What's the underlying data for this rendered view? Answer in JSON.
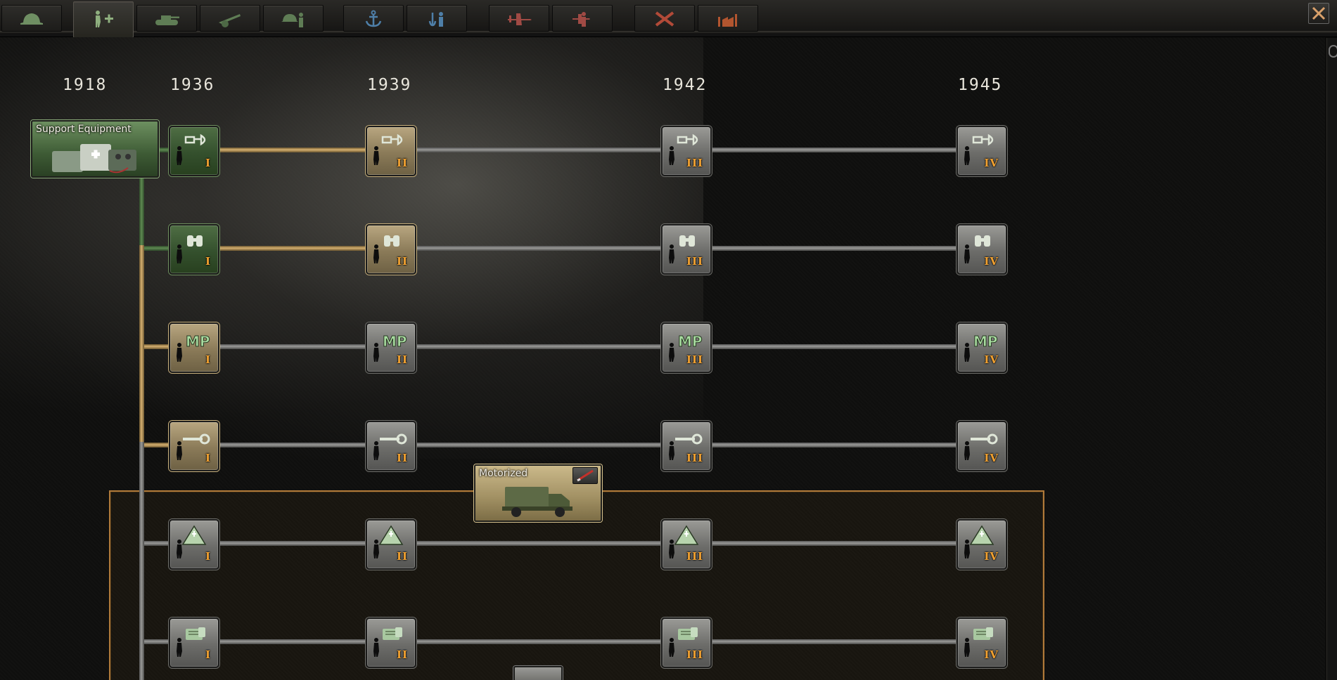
{
  "tabs": [
    {
      "id": "infantry",
      "icon": "helmet-icon"
    },
    {
      "id": "support",
      "icon": "infantry-plus-icon",
      "active": true
    },
    {
      "id": "armor",
      "icon": "tank-icon"
    },
    {
      "id": "artillery",
      "icon": "artillery-icon"
    },
    {
      "id": "land-doctrine",
      "icon": "officer-icon"
    },
    {
      "id": "naval",
      "icon": "anchor-icon"
    },
    {
      "id": "naval-doctrine",
      "icon": "naval-doctrine-icon"
    },
    {
      "id": "air",
      "icon": "plane-icon"
    },
    {
      "id": "air-doctrine",
      "icon": "air-doctrine-icon"
    },
    {
      "id": "engineering",
      "icon": "tools-icon"
    },
    {
      "id": "industry",
      "icon": "factory-icon"
    }
  ],
  "years": [
    "1918",
    "1936",
    "1939",
    "1942",
    "1945"
  ],
  "categories": {
    "support": {
      "title": "Support Equipment",
      "icon": "support-equipment-icon"
    },
    "motorized": {
      "title": "Motorized",
      "icon": "truck-icon",
      "toggle_icon": "rifle-icon"
    }
  },
  "rows": [
    {
      "id": "engineers",
      "icon": "shovel-icon",
      "levels": [
        "I",
        "II",
        "III",
        "IV"
      ],
      "state": [
        "green",
        "done",
        "none",
        "none"
      ]
    },
    {
      "id": "recon",
      "icon": "binoculars-icon",
      "levels": [
        "I",
        "II",
        "III",
        "IV"
      ],
      "state": [
        "green",
        "done",
        "none",
        "none"
      ]
    },
    {
      "id": "military-police",
      "icon": "mp-icon",
      "levels": [
        "I",
        "II",
        "III",
        "IV"
      ],
      "state": [
        "done",
        "none",
        "none",
        "none"
      ],
      "icon_text": "MP"
    },
    {
      "id": "maintenance",
      "icon": "wrench-icon",
      "levels": [
        "I",
        "II",
        "III",
        "IV"
      ],
      "state": [
        "done",
        "none",
        "none",
        "none"
      ]
    },
    {
      "id": "field-hospital",
      "icon": "tent-icon",
      "levels": [
        "I",
        "II",
        "III",
        "IV"
      ],
      "state": [
        "none",
        "none",
        "none",
        "none"
      ]
    },
    {
      "id": "logistics",
      "icon": "supply-icon",
      "levels": [
        "I",
        "II",
        "III",
        "IV"
      ],
      "state": [
        "none",
        "none",
        "none",
        "none"
      ]
    }
  ],
  "colors": {
    "accent_gold": "#d6b070",
    "level_text": "#f0a030",
    "researched_green": "#4f6e44",
    "folder_border": "#b07a3a"
  }
}
